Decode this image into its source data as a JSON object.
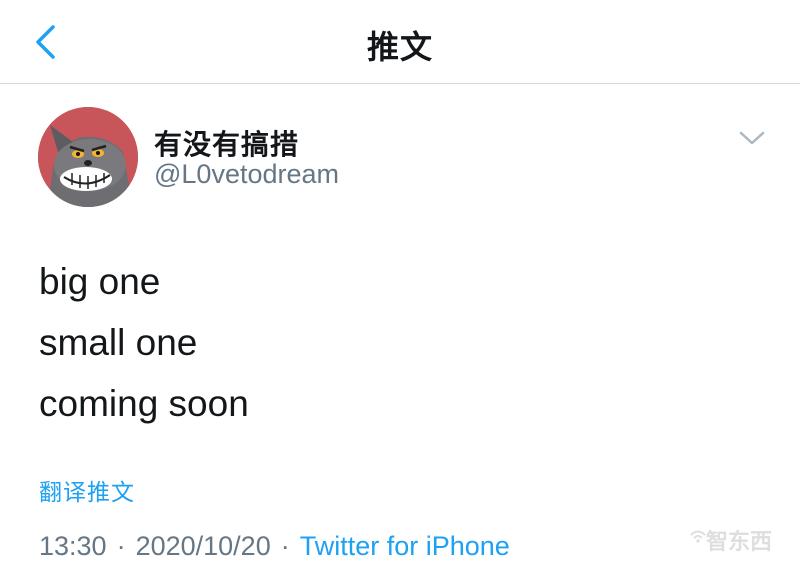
{
  "header": {
    "title": "推文",
    "back_icon": "chevron-left-icon"
  },
  "tweet": {
    "author": {
      "display_name": "有没有搞措",
      "handle": "@L0vetodream",
      "avatar_icon": "cartoon-cat-avatar"
    },
    "more_icon": "chevron-down-icon",
    "lines": [
      "big one",
      "small one",
      "coming soon"
    ],
    "translate_label": "翻译推文",
    "meta": {
      "time": "13:30",
      "separator": "·",
      "date": "2020/10/20",
      "source": "Twitter for iPhone"
    }
  },
  "watermark": {
    "text": "智东西"
  },
  "colors": {
    "accent": "#1da1f2",
    "secondary_text": "#657786",
    "primary_text": "#14171a",
    "divider": "#d6d9db"
  }
}
